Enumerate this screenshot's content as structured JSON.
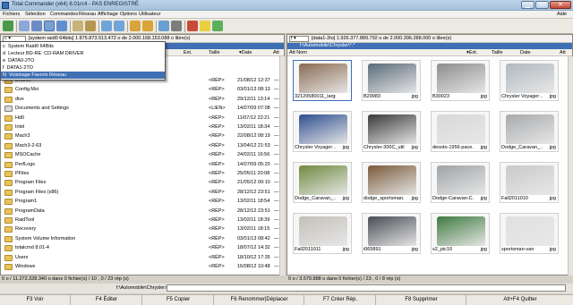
{
  "window": {
    "title": "Total Commander (x64) 8.01rc4 - PAS ENREGISTRÉ",
    "menu": [
      "Fichiers",
      "Sélection",
      "Commandes",
      "Réseau",
      "Affichage",
      "Options",
      "Utilisateur"
    ],
    "help": "Aide"
  },
  "left": {
    "drive": "c",
    "drive_info": "[system raid0 64bits]  1 875.873.513.472 o de 2.000.168.153.088 o libre(s)",
    "columns": {
      "ext": "Ext.",
      "size": "Taille",
      "date": "▾Date",
      "attr": "Att"
    },
    "dropdown": [
      {
        "letter": "c",
        "label": "System Raid0 64Bits"
      },
      {
        "letter": "d",
        "label": "Lecteur BD-RE: CD-RAM DRIVER"
      },
      {
        "letter": "e",
        "label": "DATA0-2TO"
      },
      {
        "letter": "f",
        "label": "DATA1-2TO"
      },
      {
        "letter": "N",
        "label": "Voisinage Favoris Réseau"
      }
    ],
    "rows": [
      {
        "name": "Brother",
        "size": "<RÉP>",
        "date": "21/08/12 12:37",
        "attr": "—"
      },
      {
        "name": "Config.Msi",
        "size": "<RÉP>",
        "date": "03/01/13 08:13",
        "attr": "—"
      },
      {
        "name": "divx",
        "size": "<RÉP>",
        "date": "29/12/11 13:14",
        "attr": "—"
      },
      {
        "name": "Documents and Settings",
        "size": "<LIEN>",
        "date": "14/07/09 07:08",
        "attr": "—"
      },
      {
        "name": "Hd0",
        "size": "<RÉP>",
        "date": "11/07/12 22:21",
        "attr": "—"
      },
      {
        "name": "Intel",
        "size": "<RÉP>",
        "date": "13/02/11 18:34",
        "attr": "—"
      },
      {
        "name": "Mach3",
        "size": "<RÉP>",
        "date": "22/08/12 08:19",
        "attr": "—"
      },
      {
        "name": "Mach3-2-63",
        "size": "<RÉP>",
        "date": "13/04/12 21:53",
        "attr": "—"
      },
      {
        "name": "MSOCache",
        "size": "<RÉP>",
        "date": "24/02/11 16:56",
        "attr": "—"
      },
      {
        "name": "PerfLogs",
        "size": "<RÉP>",
        "date": "14/07/09 05:20",
        "attr": "—"
      },
      {
        "name": "PFiles",
        "size": "<RÉP>",
        "date": "25/05/11 20:08",
        "attr": "—"
      },
      {
        "name": "Program Files",
        "size": "<RÉP>",
        "date": "21/05/12 00:10",
        "attr": "—"
      },
      {
        "name": "Program Files (x86)",
        "size": "<RÉP>",
        "date": "28/12/12 23:51",
        "attr": "—"
      },
      {
        "name": "Program1",
        "size": "<RÉP>",
        "date": "13/02/11 18:54",
        "attr": "—"
      },
      {
        "name": "ProgramData",
        "size": "<RÉP>",
        "date": "28/12/12 23:51",
        "attr": "—"
      },
      {
        "name": "RaidTool",
        "size": "<RÉP>",
        "date": "13/02/11 18:39",
        "attr": "—"
      },
      {
        "name": "Recovery",
        "size": "<RÉP>",
        "date": "13/02/11 18:15",
        "attr": "—"
      },
      {
        "name": "System Volume Information",
        "size": "<RÉP>",
        "date": "03/01/13 08:42",
        "attr": "—"
      },
      {
        "name": "totalcmd 8.01-4",
        "size": "<RÉP>",
        "date": "18/07/12 14:32",
        "attr": "—"
      },
      {
        "name": "Users",
        "size": "<RÉP>",
        "date": "18/10/12 17:35",
        "attr": "—"
      },
      {
        "name": "Windows",
        "size": "<RÉP>",
        "date": "16/08/12 10:48",
        "attr": "—"
      }
    ],
    "status": "0 o / 11.272.328.340 o dans 0 fichier(s) / 10 , 0 / 23 rép (s)"
  },
  "right": {
    "drive": "f",
    "drive_info": "[data1-2to]  1.926.377.889.792 o de 2.000.396.288.000 o libre(s)",
    "path": "f:\\Automobile\\Chrysler\\*.*",
    "columns": {
      "name": "Att Nom",
      "ext": "▾Ext.",
      "size": "Taille",
      "date": "Date",
      "attr": "Att"
    },
    "thumbs": [
      {
        "name": "32120580011_large.jpg",
        "ext": "",
        "color": "#8a6b53"
      },
      {
        "name": "B29983",
        "ext": "jpg",
        "color": "#5a6b7a"
      },
      {
        "name": "B30023",
        "ext": "jpg",
        "color": "#8c8c8c"
      },
      {
        "name": "Chrysler Voyager ...",
        "ext": "jpg",
        "color": "#b0b8bf"
      },
      {
        "name": "Chrysler Voyager ...",
        "ext": "jpg",
        "color": "#2f4f8f"
      },
      {
        "name": "Chrysler-300C_util...",
        "ext": "jpg",
        "color": "#3a3a3a"
      },
      {
        "name": "desoto-1956-pace...",
        "ext": "jpg",
        "color": "#d8d8d8"
      },
      {
        "name": "Dodge_Caravan_...",
        "ext": "jpg",
        "color": "#a7a9ab"
      },
      {
        "name": "Dodge_Caravan_...",
        "ext": "jpg",
        "color": "#6f8a3f"
      },
      {
        "name": "dodge_sportsman...",
        "ext": "jpg",
        "color": "#7a5a3a"
      },
      {
        "name": "Dodge-Caravan-C...",
        "ext": "jpg",
        "color": "#9fa3a6"
      },
      {
        "name": "Fall2011010",
        "ext": "jpg",
        "color": "#c9c9c9"
      },
      {
        "name": "Fall2011011",
        "ext": "jpg",
        "color": "#c3bfb8"
      },
      {
        "name": "i065891",
        "ext": "jpg",
        "color": "#4a4d55"
      },
      {
        "name": "s2_pic10",
        "ext": "jpg",
        "color": "#3f7a3f"
      },
      {
        "name": "sportsman-van",
        "ext": "jpg",
        "color": "#e0e0e0"
      }
    ],
    "status": "0 o / 3.579.888 o dans 0 fichier(s) / 23 , 0 / 8 rép (s)"
  },
  "cmdline": {
    "label": "f:\\Automobile\\Chrysler>",
    "value": ""
  },
  "fkeys": [
    "F3 Voir",
    "F4 Éditer",
    "F5 Copier",
    "F6 Renommer|Déplacer",
    "F7 Créer Rép.",
    "F8 Supprimer",
    "Alt+F4 Quitter"
  ],
  "toolbar_icons": [
    "refresh-icon",
    "view-brief-icon",
    "view-full-icon",
    "view-thumbs-icon",
    "tree-icon",
    "sort-name-icon",
    "sort-ext-icon",
    "back-icon",
    "forward-icon",
    "pack-icon",
    "unpack-icon",
    "ftp-icon",
    "find-icon",
    "rename-icon",
    "notepad-icon",
    "sync-icon"
  ]
}
